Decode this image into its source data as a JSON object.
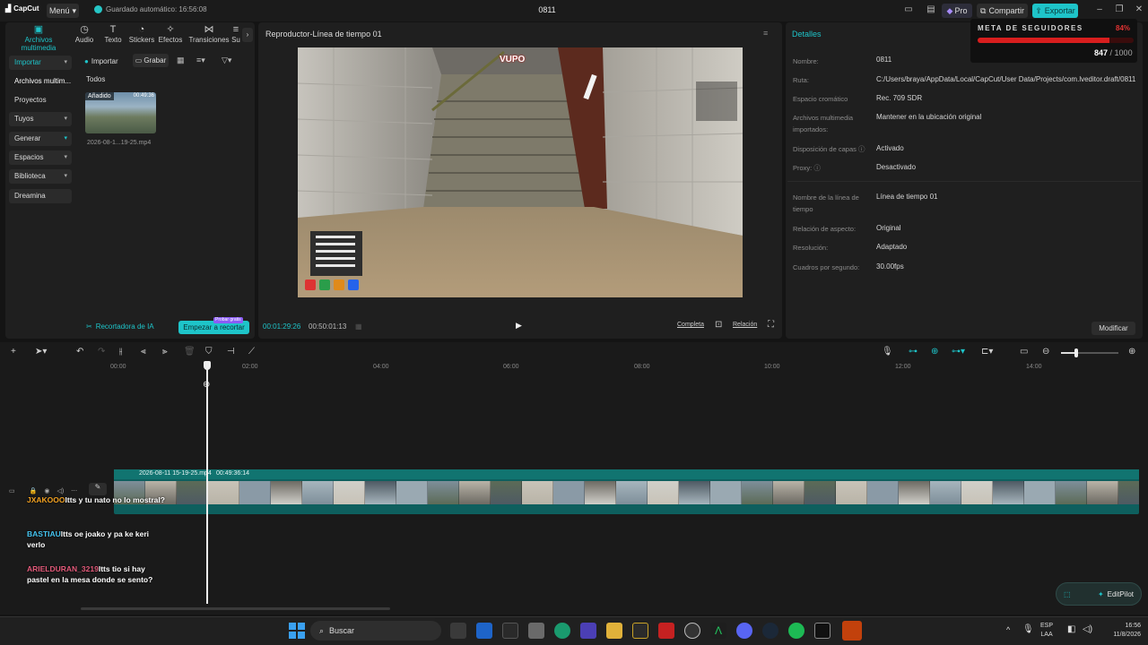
{
  "app": {
    "logo": "CapCut",
    "menu": "Menú",
    "autosave": "Guardado automático: 16:56:08",
    "project_title": "0811",
    "pro": "Pro",
    "share": "Compartir",
    "export": "Exportar"
  },
  "tools": [
    "Archivos multimedia",
    "Audio",
    "Texto",
    "Stickers",
    "Efectos",
    "Transiciones",
    "Su"
  ],
  "sidebar": [
    {
      "label": "Importar",
      "boxed": true,
      "chev": "▾"
    },
    {
      "label": "Archivos multim...",
      "boxed": false,
      "chev": ""
    },
    {
      "label": "Proyectos secun...",
      "boxed": false,
      "chev": ""
    },
    {
      "label": "Tuyos",
      "boxed": true,
      "chev": "▾"
    },
    {
      "label": "Generar",
      "boxed": true,
      "chev": "▾"
    },
    {
      "label": "Espacios",
      "boxed": true,
      "chev": "▾"
    },
    {
      "label": "Biblioteca",
      "boxed": true,
      "chev": "▾"
    },
    {
      "label": "Dreamina",
      "boxed": true,
      "chev": ""
    }
  ],
  "media": {
    "import": "Importar",
    "record": "Grabar",
    "all": "Todos",
    "thumb_badge": "Añadido",
    "thumb_dur": "00:49:36",
    "file_name": "2026-08-1...19-25.mp4",
    "ai_recorder": "Recortadora de IA",
    "start_trim": "Empezar a recortar",
    "try_free": "Probar gratis"
  },
  "player": {
    "title": "Reproductor-Línea de tiempo 01",
    "current": "00:01:29:26",
    "total": "00:50:01:13",
    "complete": "Completa",
    "ratio": "Relación",
    "overlay_logo": "VUPO"
  },
  "details": {
    "title": "Detalles",
    "rows": [
      {
        "label": "Nombre:",
        "value": "0811"
      },
      {
        "label": "Ruta:",
        "value": "C:/Users/braya/AppData/Local/CapCut/User Data/Projects/com.lveditor.draft/0811"
      },
      {
        "label": "Espacio cromático",
        "value": "Rec. 709 SDR"
      },
      {
        "label": "Archivos multimedia importados:",
        "value": "Mantener en la ubicación original"
      },
      {
        "label": "Disposición de capas ⓘ",
        "value": "Activado"
      },
      {
        "label": "Proxy: ⓘ",
        "value": "Desactivado"
      },
      {
        "label": "Nombre de la línea de tiempo",
        "value": "Línea de tiempo 01"
      },
      {
        "label": "Relación de aspecto:",
        "value": "Original"
      },
      {
        "label": "Resolución:",
        "value": "Adaptado"
      },
      {
        "label": "Cuadros por segundo:",
        "value": "30.00fps"
      }
    ],
    "modify": "Modificar"
  },
  "followers": {
    "title": "META DE SEGUIDORES",
    "percent": "84%",
    "fraction": 0.847,
    "count": "847",
    "goal": "/ 1000"
  },
  "timeline": {
    "ticks": [
      "00:00",
      "02:00",
      "04:00",
      "06:00",
      "08:00",
      "10:00",
      "12:00",
      "14:00"
    ],
    "clip_name": "2026-08-11 15-19-25.mp4",
    "clip_duration": "00:49:36:14"
  },
  "chat": [
    {
      "user": "JXAKOOO",
      "msg": "ltts y tu nato no lo mostral?"
    },
    {
      "user": "BASTIAU",
      "msg": "ltts oe joako y pa ke keri verlo"
    },
    {
      "user": "ARIELDURAN_3219",
      "msg": "ltts tio si hay pastel en la mesa donde se sento?"
    }
  ],
  "editpilot": "EditPilot",
  "taskbar": {
    "search": "Buscar",
    "lang_top": "ESP",
    "lang_bottom": "LAA",
    "time": "16:56",
    "date": "11/8/2026"
  }
}
